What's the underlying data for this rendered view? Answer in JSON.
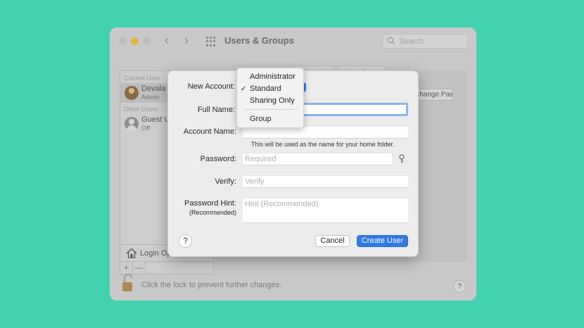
{
  "window": {
    "title": "Users & Groups",
    "search_placeholder": "Search",
    "nav_back": "‹",
    "nav_forward": "›"
  },
  "sidebar": {
    "current_user_header": "Current User",
    "current_user": {
      "name": "Devala R",
      "role": "Admin"
    },
    "other_users_header": "Other Users",
    "guest_user": {
      "name": "Guest User",
      "role": "Off"
    },
    "login_options_label": "Login Options",
    "add_label": "+",
    "remove_label": "—"
  },
  "background_tabs": [
    "Password",
    "Login Items"
  ],
  "background_password_button": "Change Password...",
  "lock_text": "Click the lock to prevent further changes.",
  "help_label": "?",
  "sheet": {
    "new_account_label": "New Account:",
    "full_name_label": "Full Name:",
    "account_name_label": "Account Name:",
    "account_name_hint": "This will be used as the name for your home folder.",
    "password_label": "Password:",
    "password_placeholder": "Required",
    "verify_label": "Verify:",
    "verify_placeholder": "Verify",
    "password_hint_label": "Password Hint:",
    "password_hint_sublabel": "(Recommended)",
    "password_hint_placeholder": "Hint (Recommended)",
    "help_label": "?",
    "cancel_label": "Cancel",
    "create_label": "Create User"
  },
  "account_type_menu": {
    "items": [
      "Administrator",
      "Standard",
      "Sharing Only",
      "Group"
    ],
    "selected": "Standard",
    "check": "✓"
  },
  "colors": {
    "background": "#42d2b0",
    "accent": "#2f7ae6",
    "focus_ring": "#8ab4ef"
  }
}
